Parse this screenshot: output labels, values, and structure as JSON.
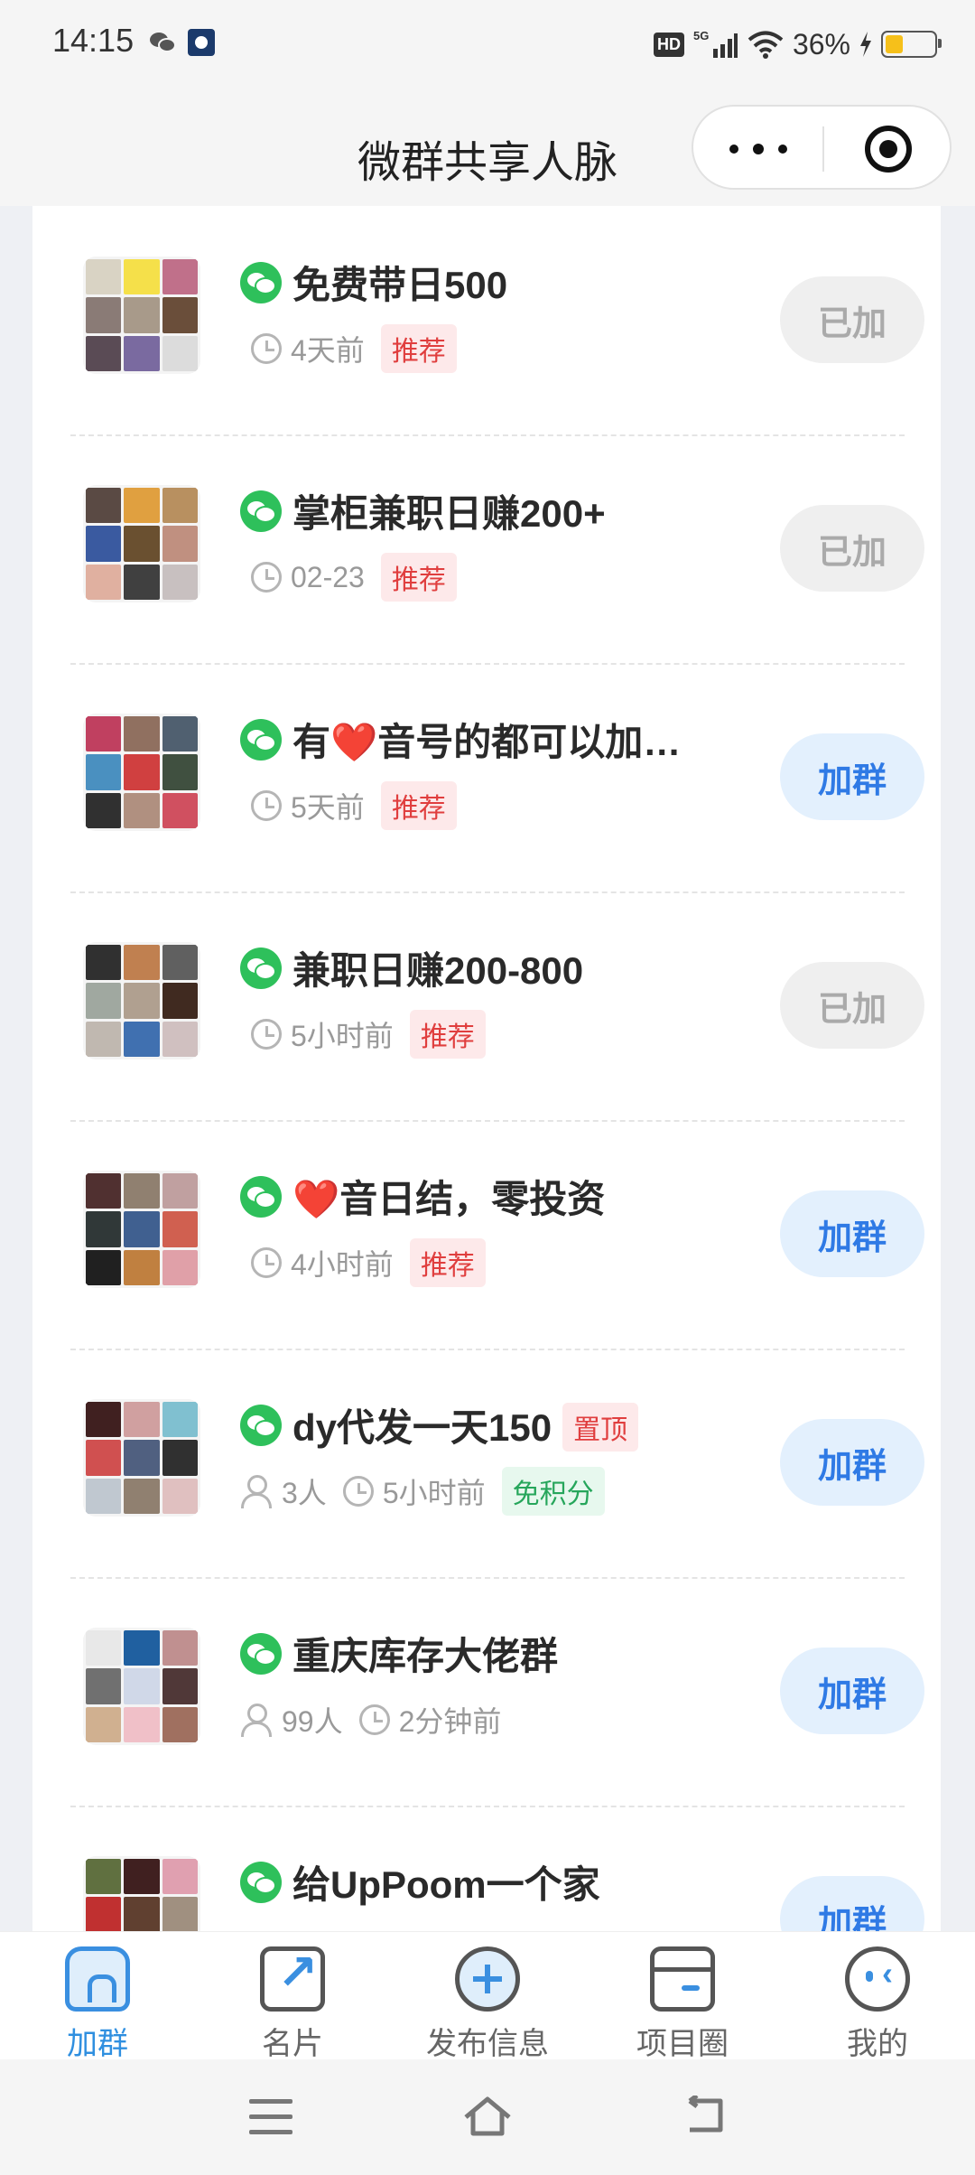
{
  "status_bar": {
    "time": "14:15",
    "hd": "HD",
    "network": "5G",
    "battery": "36%",
    "icons": [
      "wechat-icon",
      "app-icon",
      "signal-icon",
      "wifi-icon",
      "charging-icon",
      "battery-icon"
    ]
  },
  "nav": {
    "title": "微群共享人脉",
    "more_icon": "more-dots-icon",
    "close_icon": "target-close-icon"
  },
  "colors": {
    "accent": "#2f7ae5",
    "tab_active": "#2f8fe0",
    "wechat_green": "#2ec05b",
    "recommend_red": "#e03e3e",
    "free_green": "#26a65b"
  },
  "groups": [
    {
      "title": "免费带日500",
      "time": "4天前",
      "tag": "推荐",
      "button": "已加"
    },
    {
      "title": "掌柜兼职日赚200+",
      "time": "02-23",
      "tag": "推荐",
      "button": "已加"
    },
    {
      "title": "有❤️音号的都可以加…",
      "time": "5天前",
      "tag": "推荐",
      "button": "加群"
    },
    {
      "title": "兼职日赚200-800",
      "time": "5小时前",
      "tag": "推荐",
      "button": "已加"
    },
    {
      "title": "❤️音日结，零投资",
      "time": "4小时前",
      "tag": "推荐",
      "button": "加群"
    },
    {
      "title": "dy代发一天150",
      "pin": "置顶",
      "members": "3人",
      "time": "5小时前",
      "tag": "免积分",
      "button": "加群"
    },
    {
      "title": "重庆库存大佬群",
      "members": "99人",
      "time": "2分钟前",
      "button": "加群"
    },
    {
      "title": "给UpPoom一个家",
      "button": "加群"
    }
  ],
  "tabs": [
    {
      "label": "加群",
      "icon": "home-icon"
    },
    {
      "label": "名片",
      "icon": "share-card-icon"
    },
    {
      "label": "发布信息",
      "icon": "plus-circle-icon"
    },
    {
      "label": "项目圈",
      "icon": "wallet-icon"
    },
    {
      "label": "我的",
      "icon": "face-icon"
    }
  ],
  "system_nav": {
    "icons": [
      "menu-icon",
      "home-outline-icon",
      "back-icon"
    ]
  }
}
